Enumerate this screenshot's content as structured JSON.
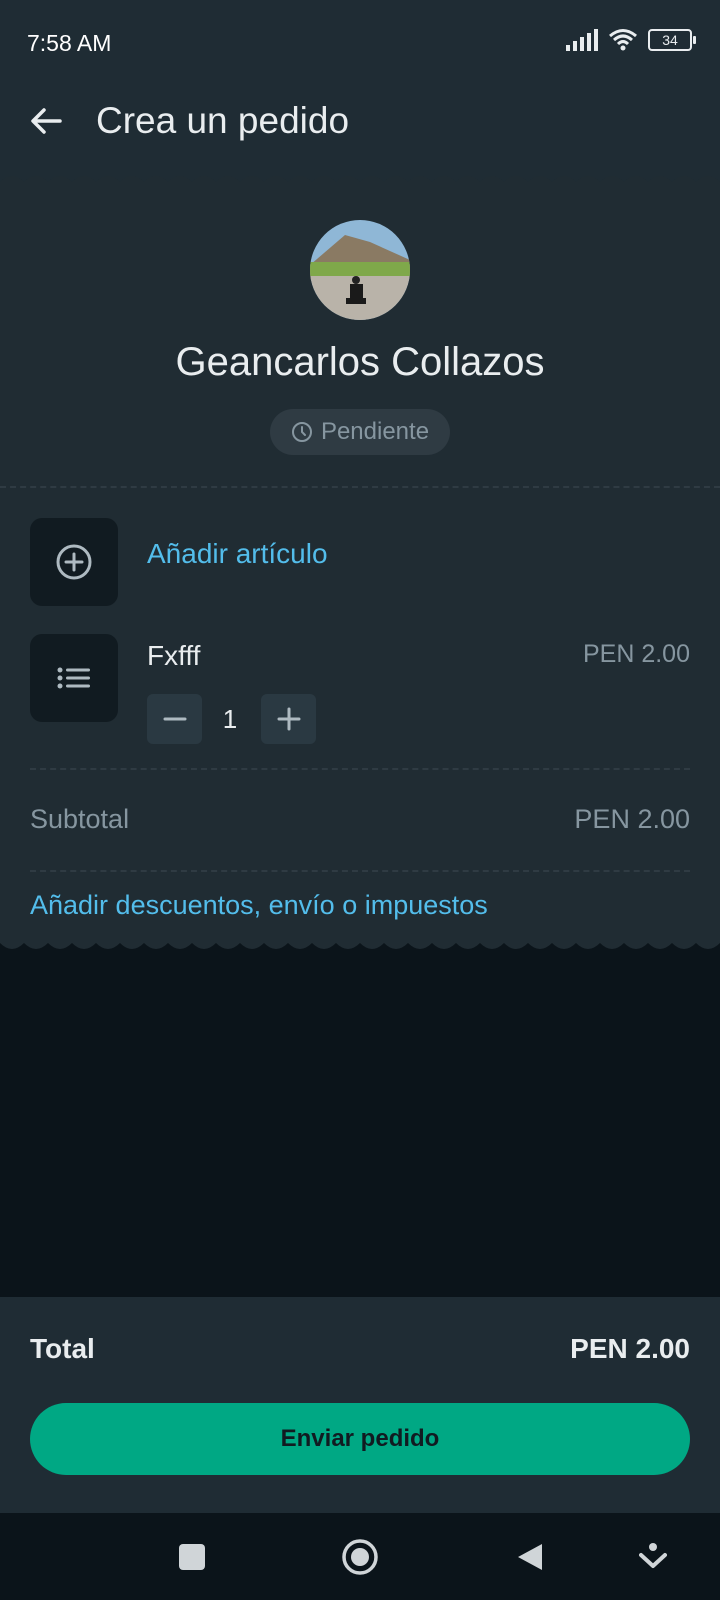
{
  "status_bar": {
    "time": "7:58 AM",
    "battery": "34",
    "icons": [
      "signal-icon",
      "wifi-icon",
      "battery-icon"
    ]
  },
  "app_bar": {
    "title": "Crea un pedido",
    "back_icon": "arrow-left-icon"
  },
  "order": {
    "contact_name": "Geancarlos Collazos",
    "status": "Pendiente",
    "add_item_label": "Añadir artículo",
    "items": [
      {
        "name": "Fxfff",
        "price": "PEN 2.00",
        "quantity": "1"
      }
    ],
    "subtotal_label": "Subtotal",
    "subtotal_value": "PEN 2.00",
    "extras_label": "Añadir descuentos, envío o impuestos"
  },
  "footer": {
    "total_label": "Total",
    "total_value": "PEN 2.00",
    "send_label": "Enviar pedido"
  },
  "nav_bar": {
    "icons": [
      "square-icon",
      "home-circle-icon",
      "back-triangle-icon",
      "menu-down-icon"
    ]
  },
  "colors": {
    "background": "#0b141a",
    "panel": "#1f2c34",
    "card": "#202c33",
    "accent_link": "#53bdeb",
    "accent_button": "#00a884",
    "muted_text": "#8696a0"
  }
}
